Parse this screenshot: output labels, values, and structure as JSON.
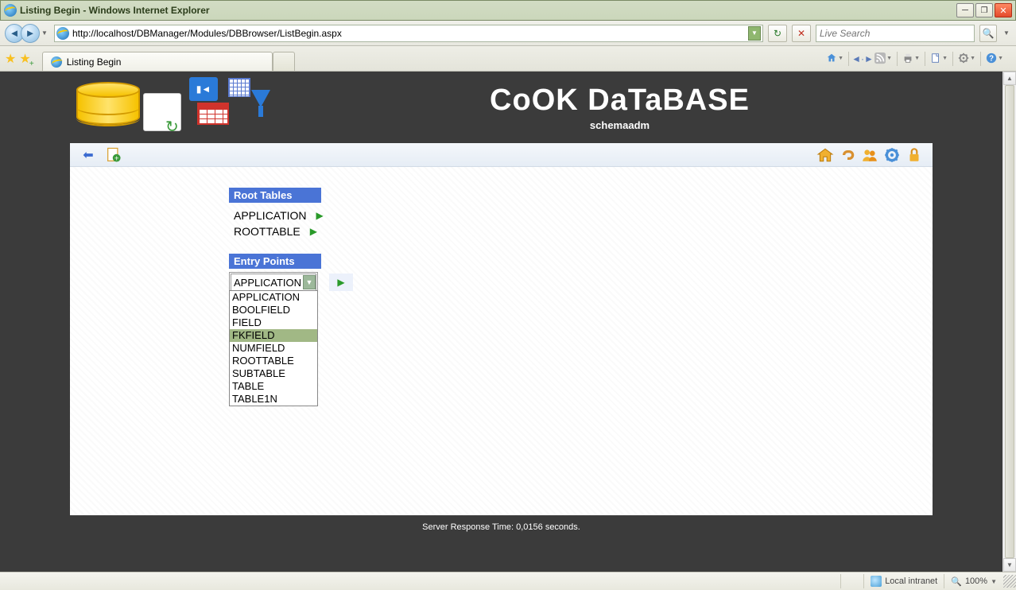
{
  "window": {
    "title": "Listing Begin - Windows Internet Explorer"
  },
  "nav": {
    "url": "http://localhost/DBManager/Modules/DBBrowser/ListBegin.aspx",
    "search_placeholder": "Live Search"
  },
  "tabs": {
    "active_title": "Listing Begin"
  },
  "banner": {
    "title": "CoOK DaTaBASE",
    "subtitle": "schemaadm"
  },
  "root_tables": {
    "header": "Root Tables",
    "items": [
      "APPLICATION",
      "ROOTTABLE"
    ]
  },
  "entry_points": {
    "header": "Entry Points",
    "selected": "APPLICATION",
    "options": [
      "APPLICATION",
      "BOOLFIELD",
      "FIELD",
      "FKFIELD",
      "NUMFIELD",
      "ROOTTABLE",
      "SUBTABLE",
      "TABLE",
      "TABLE1N"
    ],
    "highlighted_index": 3
  },
  "footer": {
    "response_time": "Server Response Time: 0,0156 seconds."
  },
  "statusbar": {
    "zone": "Local intranet",
    "zoom": "100%"
  }
}
